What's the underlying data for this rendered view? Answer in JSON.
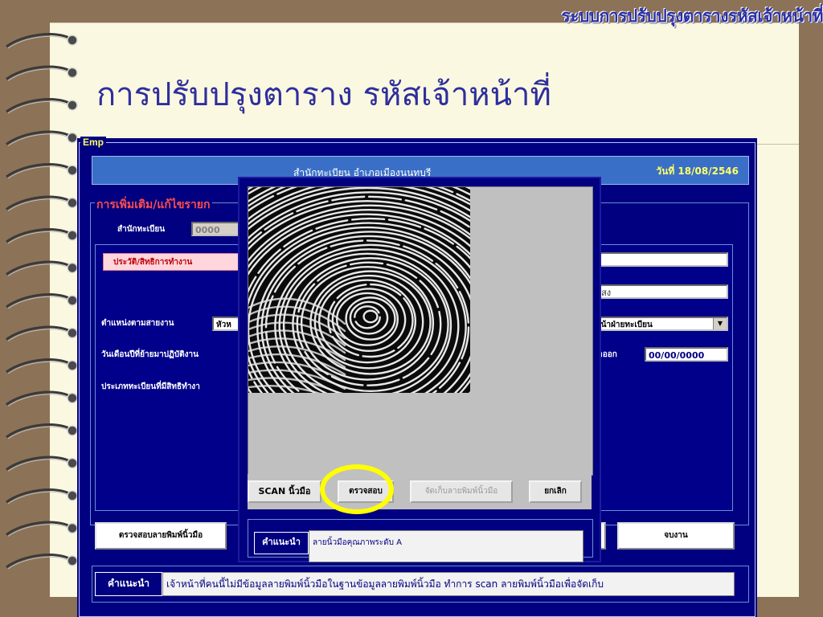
{
  "banner": "ระบบการปรับปรุงตารางรหัสเจ้าหน้าที่",
  "slide_title": "การปรับปรุงตาราง รหัสเจ้าหน้าที่",
  "window": {
    "label": "Emp",
    "office": "สำนักทะเบียน อำเภอเมืองนนทบุรี",
    "date": "วันที่ 18/08/2546"
  },
  "form": {
    "section_title": "การเพิ่มเติม/แก้ไขรายก",
    "registry_label": "สำนักทะเบียน",
    "registry_value": "0000",
    "tab_label": "ประวัติ/สิทธิการทำงาน",
    "position_label": "ตำแหน่งตามสายงาน",
    "position_value": "หัวห",
    "date_moved_label": "วันเดือนปีที่ย้ายมาปฏิบัติงาน",
    "registry_type_label": "ประเภททะเบียนที่มีสิทธิทำงา",
    "name_partial": "แสง",
    "dropdown_value": "หน้าฝ่ายทะเบียน",
    "leave_label": "ลาออก",
    "leave_date": "00/00/0000"
  },
  "buttons": {
    "check_fingerprint": "ตรวจสอบลายพิมพ์นิ้วมือ",
    "finish": "จบงาน"
  },
  "hint": {
    "tag": "คำแนะนำ",
    "text": "เจ้าหน้าที่คนนี้ไม่มีข้อมูลลายพิมพ์นิ้วมือในฐานข้อมูลลายพิมพ์นิ้วมือ  ทำการ scan ลายพิมพ์นิ้วมือเพื่อจัดเก็บ"
  },
  "dialog": {
    "scan": "SCAN นิ้วมือ",
    "verify": "ตรวจสอบ",
    "store": "จัดเก็บลายพิมพ์นิ้วมือ",
    "cancel": "ยกเลิก",
    "hint_tag": "คำแนะนำ",
    "hint_text": "ลายนิ้วมือคุณภาพระดับ A"
  },
  "colors": {
    "background": "#8c7257",
    "slide": "#fbf8e1",
    "window": "#000080",
    "header_bar": "#3a6fc7",
    "highlight": "#ffff00",
    "title": "#2e2f9c"
  }
}
